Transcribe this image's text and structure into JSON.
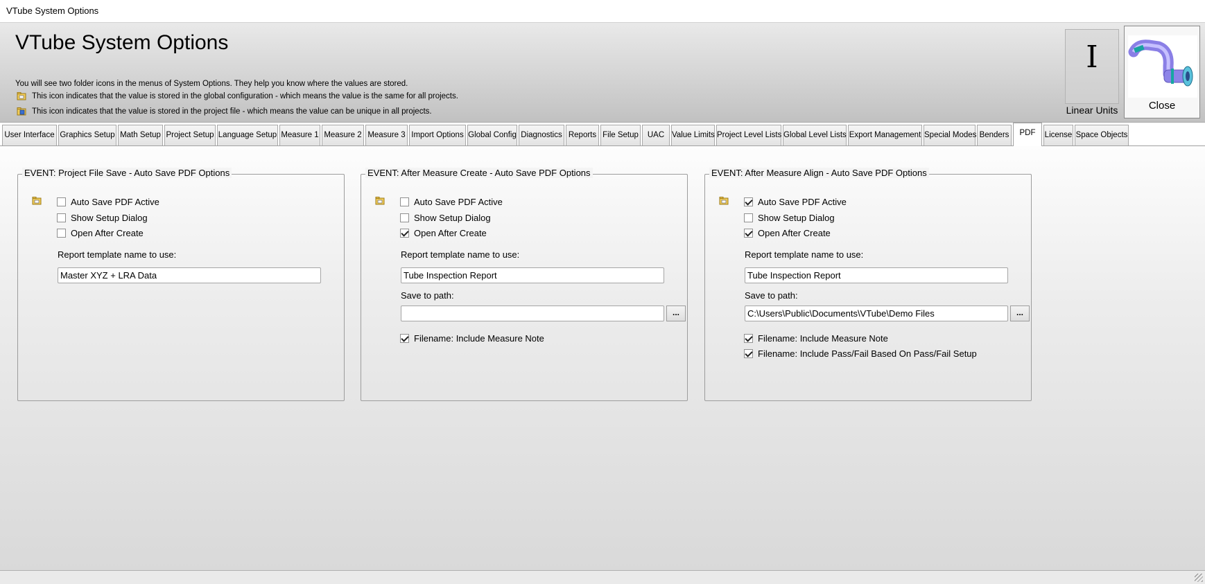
{
  "window": {
    "title": "VTube System Options"
  },
  "header": {
    "title": "VTube System Options",
    "line1": "You will see two folder icons in the menus of System Options.  They help you know where the values are stored.",
    "line2": "This icon indicates that the value is stored in the global configuration - which means the value is the same for all projects.",
    "line3": "This icon indicates that the value is stored in the project file - which means the value can be unique in all projects.",
    "units_glyph": "I",
    "units_label": "Linear Units",
    "close_label": "Close"
  },
  "tabs": [
    "User Interface",
    "Graphics Setup",
    "Math Setup",
    "Project Setup",
    "Language Setup",
    "Measure 1",
    "Measure 2",
    "Measure 3",
    "Import Options",
    "Global Config",
    "Diagnostics",
    "Reports",
    "File Setup",
    "UAC",
    "Value Limits",
    "Project Level Lists",
    "Global Level Lists",
    "Export Management",
    "Special Modes",
    "Benders",
    "PDF",
    "License",
    "Space Objects"
  ],
  "active_tab": "PDF",
  "groups": [
    {
      "legend": "EVENT: Project File Save - Auto Save PDF Options",
      "auto_save_label": "Auto Save PDF Active",
      "auto_save_checked": false,
      "show_setup_label": "Show Setup Dialog",
      "show_setup_checked": false,
      "open_after_label": "Open After Create",
      "open_after_checked": false,
      "template_label": "Report template name to use:",
      "template_value": "Master XYZ + LRA Data"
    },
    {
      "legend": "EVENT: After Measure Create - Auto Save PDF Options",
      "auto_save_label": "Auto Save PDF Active",
      "auto_save_checked": false,
      "show_setup_label": "Show Setup Dialog",
      "show_setup_checked": false,
      "open_after_label": "Open After Create",
      "open_after_checked": true,
      "template_label": "Report template name to use:",
      "template_value": "Tube Inspection Report",
      "path_label": "Save to path:",
      "path_value": "",
      "browse_label": "...",
      "note_label": "Filename: Include Measure Note",
      "note_checked": true
    },
    {
      "legend": "EVENT: After Measure Align - Auto Save PDF Options",
      "auto_save_label": "Auto Save PDF Active",
      "auto_save_checked": true,
      "show_setup_label": "Show Setup Dialog",
      "show_setup_checked": false,
      "open_after_label": "Open After Create",
      "open_after_checked": true,
      "template_label": "Report template name to use:",
      "template_value": "Tube Inspection Report",
      "path_label": "Save to path:",
      "path_value": "C:\\Users\\Public\\Documents\\VTube\\Demo Files",
      "browse_label": "...",
      "note_label": "Filename: Include Measure Note",
      "note_checked": true,
      "passfail_label": "Filename: Include Pass/Fail Based On Pass/Fail Setup",
      "passfail_checked": true
    }
  ]
}
